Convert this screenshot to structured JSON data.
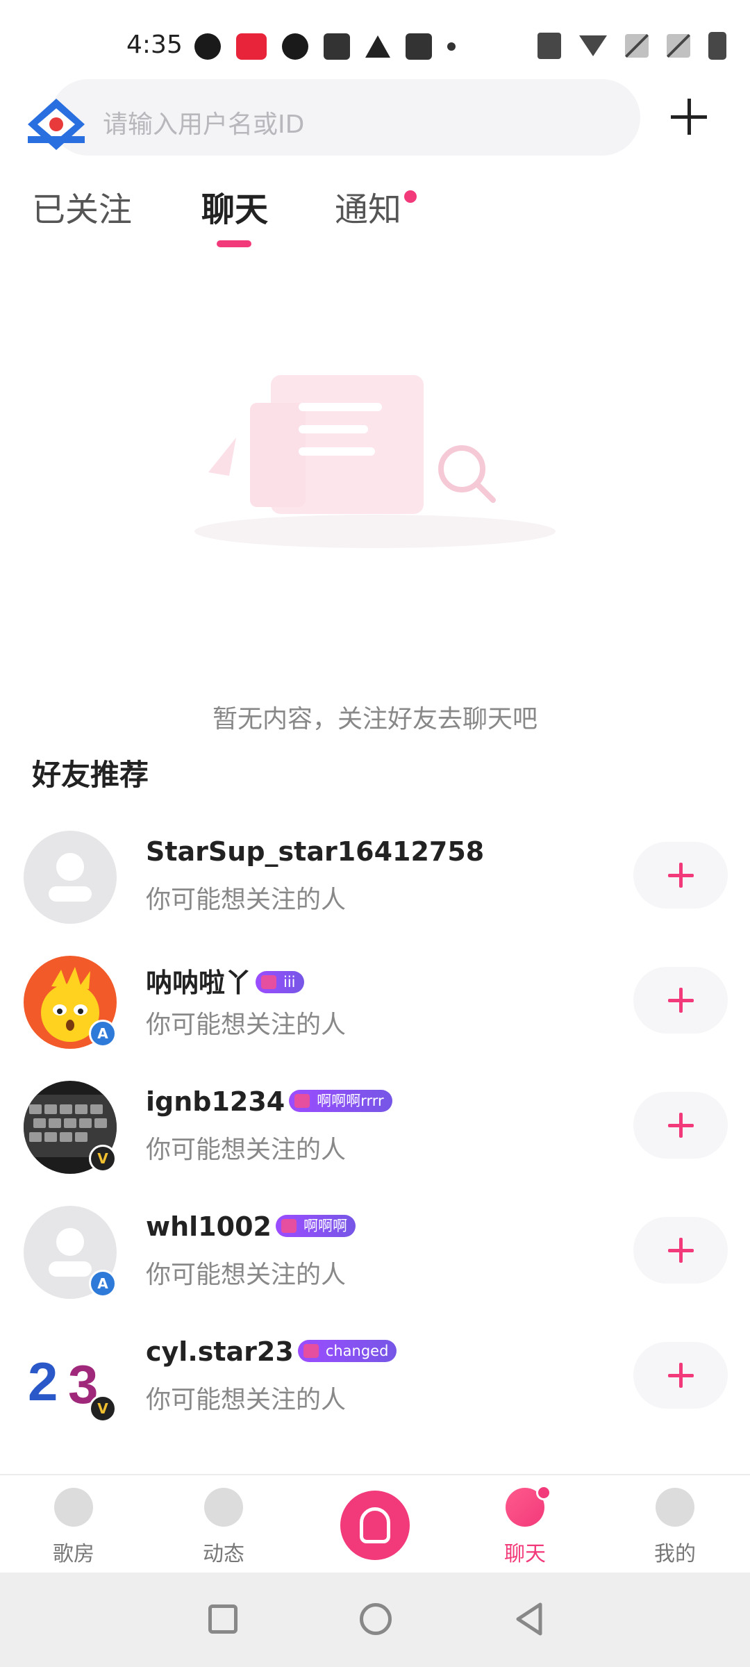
{
  "status_bar": {
    "time": "4:35"
  },
  "header": {
    "search_placeholder": "请输入用户名或ID"
  },
  "tabs": [
    {
      "label": "已关注"
    },
    {
      "label": "聊天"
    },
    {
      "label": "通知"
    }
  ],
  "empty_state": {
    "text": "暂无内容，关注好友去聊天吧"
  },
  "recommend": {
    "title": "好友推荐",
    "users": [
      {
        "name": "StarSup_star16412758",
        "tag": "",
        "subtitle": "你可能想关注的人"
      },
      {
        "name": "呐呐啦丫",
        "tag": "iii",
        "subtitle": "你可能想关注的人"
      },
      {
        "name": "ignb1234",
        "tag": "啊啊啊rrrr",
        "subtitle": "你可能想关注的人"
      },
      {
        "name": "whl1002",
        "tag": "啊啊啊",
        "subtitle": "你可能想关注的人"
      },
      {
        "name": "cyl.star23",
        "tag": "changed",
        "subtitle": "你可能想关注的人"
      }
    ]
  },
  "bottom_nav": [
    {
      "label": "歌房"
    },
    {
      "label": "动态"
    },
    {
      "label": "聊天"
    },
    {
      "label": "我的"
    }
  ],
  "colors": {
    "accent": "#f23a7a",
    "tag": "#7656e6"
  }
}
